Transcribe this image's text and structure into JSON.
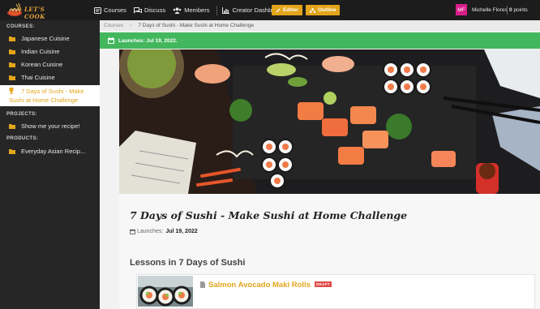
{
  "logo": {
    "text": "LET'S COOK"
  },
  "nav": {
    "courses": "Courses",
    "discuss": "Discuss",
    "members": "Members",
    "creator_dashboard": "Creator Dashboard",
    "editor": "Editor",
    "outline": "Outline"
  },
  "user": {
    "initials": "MF",
    "name": "Michelle Flores",
    "points_value": "0",
    "points_label": "points"
  },
  "sidebar": {
    "courses_label": "COURSES:",
    "courses": [
      {
        "label": "Japanese Cuisine"
      },
      {
        "label": "Indian Cuisine"
      },
      {
        "label": "Korean Cuisine"
      },
      {
        "label": "Thai Cuisine"
      },
      {
        "label": "7 Days of Sushi - Make Sushi at Home Challenge"
      }
    ],
    "projects_label": "PROJECTS:",
    "projects": [
      {
        "label": "Show me your recipe!"
      }
    ],
    "products_label": "PRODUCTS:",
    "products": [
      {
        "label": "Everyday Asian Recip..."
      }
    ]
  },
  "breadcrumb": {
    "root": "Courses",
    "current": "7 Days of Sushi - Make Sushi at Home Challenge"
  },
  "banner": {
    "text": "Launches: Jul 19, 2022."
  },
  "course": {
    "title": "7 Days of Sushi - Make Sushi at Home Challenge",
    "launch_label": "Launches:",
    "launch_date": "Jul 19, 2022"
  },
  "lessons": {
    "heading": "Lessons in 7 Days of Sushi",
    "items": [
      {
        "title": "Salmon Avocado Maki Rolls",
        "badge": "DRAFT"
      }
    ]
  },
  "colors": {
    "accent": "#e3a51b",
    "banner": "#43b75e",
    "sidebar": "#262626",
    "topbar": "#1c1c1c",
    "draft": "#e24a4a",
    "avatar": "#d91e8a"
  }
}
